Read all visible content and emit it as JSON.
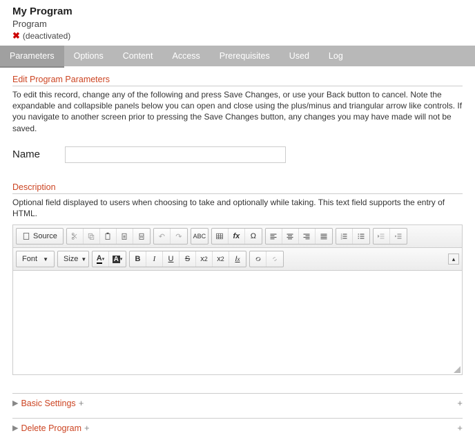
{
  "header": {
    "title": "My Program",
    "subtitle": "Program",
    "status": "(deactivated)"
  },
  "tabs": {
    "items": [
      "Parameters",
      "Options",
      "Content",
      "Access",
      "Prerequisites",
      "Used",
      "Log"
    ],
    "active": 0
  },
  "parameters": {
    "section_title": "Edit Program Parameters",
    "help": "To edit this record, change any of the following and press Save Changes, or use your Back button to cancel. Note the expandable and collapsible panels below you can open and close using the plus/minus and triangular arrow like controls. If you navigate to another screen prior to pressing the Save Changes button, any changes you may have made will not be saved.",
    "name_label": "Name",
    "name_value": ""
  },
  "description": {
    "section_title": "Description",
    "help": "Optional field displayed to users when choosing to take and optionally while taking. This text field supports the entry of HTML."
  },
  "editor_toolbar": {
    "source": "Source",
    "font": "Font",
    "size": "Size"
  },
  "panels": {
    "basic": "Basic Settings",
    "delete": "Delete Program"
  }
}
